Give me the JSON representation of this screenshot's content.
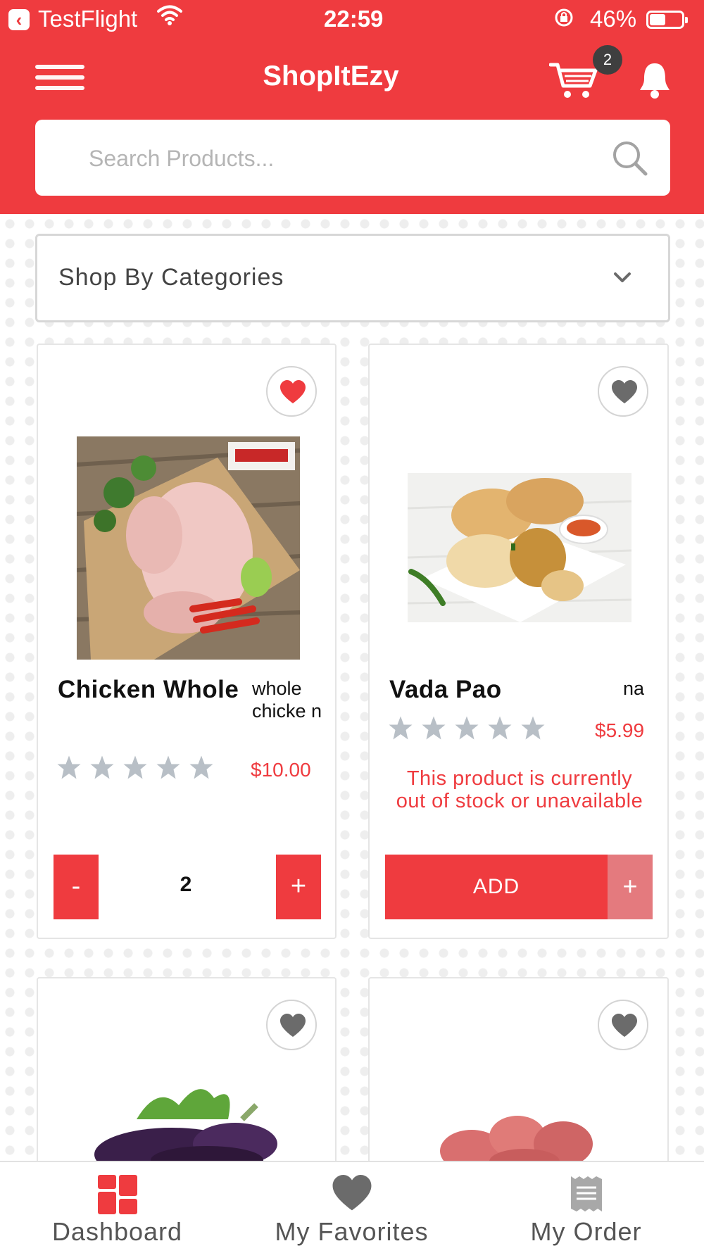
{
  "status_bar": {
    "back_app": "TestFlight",
    "time": "22:59",
    "battery": "46%"
  },
  "header": {
    "title": "ShopItEzy",
    "cart_count": "2"
  },
  "search": {
    "placeholder": "Search Products..."
  },
  "categories": {
    "label": "Shop By Categories"
  },
  "products": [
    {
      "name": "Chicken Whole",
      "description": "whole chicke n",
      "price": "$10.00",
      "rating": 0,
      "favorite": true,
      "quantity": "2",
      "minus_label": "-",
      "plus_label": "+"
    },
    {
      "name": "Vada Pao",
      "description": "na",
      "price": "$5.99",
      "rating": 0,
      "favorite": false,
      "stock_message": "This product is currently out of stock or unavailable",
      "add_label": "ADD",
      "plus_label": "+"
    },
    {
      "favorite": false
    },
    {
      "favorite": false
    }
  ],
  "bottom_nav": {
    "items": [
      {
        "label": "Dashboard",
        "icon": "dashboard-icon",
        "active": true
      },
      {
        "label": "My Favorites",
        "icon": "heart-icon",
        "active": false
      },
      {
        "label": "My Order",
        "icon": "receipt-icon",
        "active": false
      }
    ]
  },
  "colors": {
    "brand_red": "#ef3b3f",
    "disabled_red": "#e47a7e",
    "star_grey": "#b8bfc6",
    "icon_grey": "#6b6b6b"
  }
}
